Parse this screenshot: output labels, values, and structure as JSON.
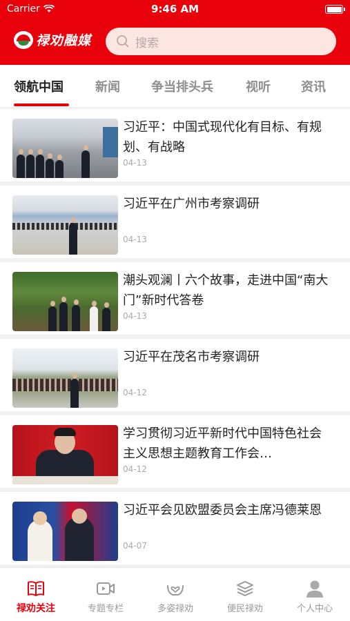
{
  "status_bar": {
    "carrier": "Carrier",
    "time": "9:46 AM",
    "battery": 1.0
  },
  "header": {
    "logo_text": "禄劝融媒",
    "search": {
      "placeholder": "搜索",
      "icon": "search-icon"
    }
  },
  "tabs": [
    {
      "label": "领航中国",
      "active": true
    },
    {
      "label": "新闻",
      "active": false
    },
    {
      "label": "争当排头兵",
      "active": false
    },
    {
      "label": "视听",
      "active": false
    },
    {
      "label": "资讯",
      "active": false
    }
  ],
  "articles": [
    {
      "title": "习近平：中国式现代化有目标、有规划、有战略",
      "date": "04-13"
    },
    {
      "title": "习近平在广州市考察调研",
      "date": "04-13"
    },
    {
      "title": "潮头观澜丨六个故事，走进中国“南大门”新时代答卷",
      "date": "04-13"
    },
    {
      "title": "习近平在茂名市考察调研",
      "date": "04-12"
    },
    {
      "title": "学习贯彻习近平新时代中国特色社会主义思想主题教育工作会…",
      "date": "04-12"
    },
    {
      "title": "习近平会见欧盟委员会主席冯德莱恩",
      "date": "04-07"
    }
  ],
  "tabbar": [
    {
      "label": "禄劝关注",
      "icon": "book-icon",
      "active": true
    },
    {
      "label": "专题专栏",
      "icon": "video-camera-icon",
      "active": false
    },
    {
      "label": "多姿禄劝",
      "icon": "hands-heart-icon",
      "active": false
    },
    {
      "label": "便民禄劝",
      "icon": "layers-icon",
      "active": false
    },
    {
      "label": "个人中心",
      "icon": "person-icon",
      "active": false
    }
  ],
  "colors": {
    "brand_red": "#e8000b",
    "search_bg": "#fde6e2",
    "text_dark": "#222222",
    "text_muted": "#999999"
  }
}
